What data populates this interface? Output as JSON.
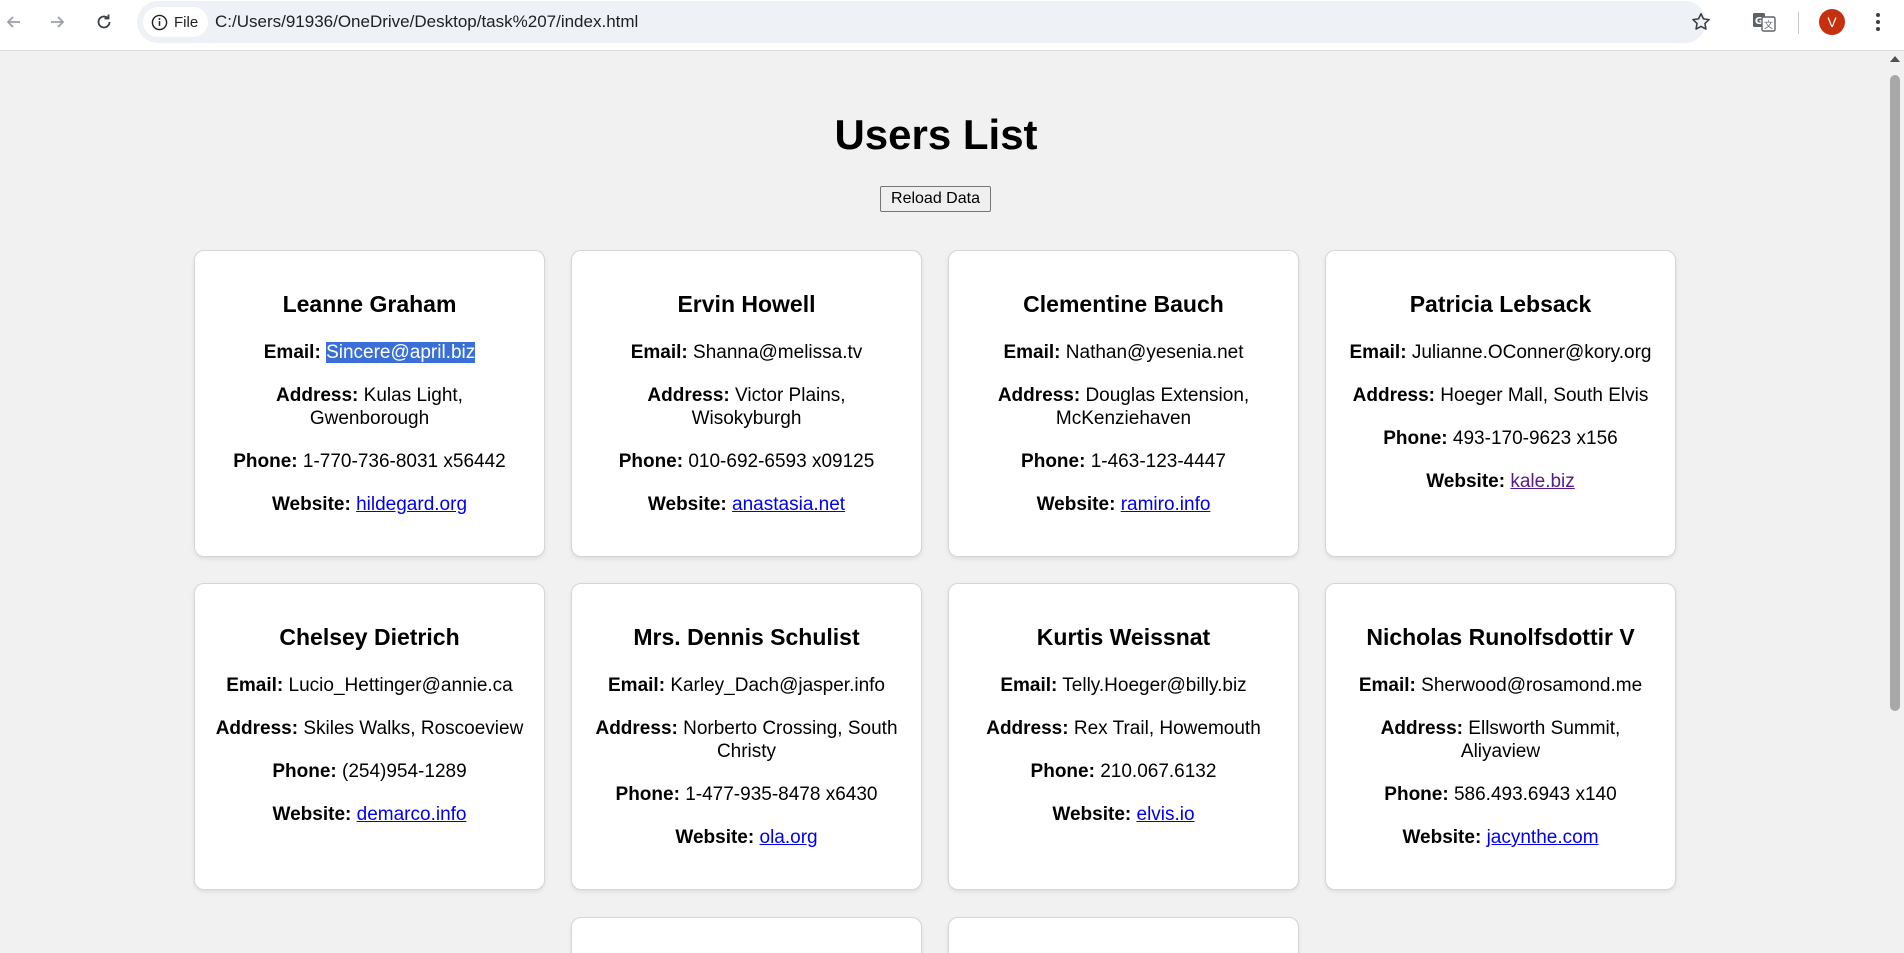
{
  "browser": {
    "file_label": "File",
    "url": "C:/Users/91936/OneDrive/Desktop/task%207/index.html",
    "avatar_letter": "V",
    "icons": [
      "back-arrow-icon",
      "forward-arrow-icon",
      "reload-icon",
      "info-icon",
      "star-icon",
      "translate-icon",
      "menu-dots-icon"
    ]
  },
  "page": {
    "title": "Users List",
    "reload_button": "Reload Data"
  },
  "labels": {
    "email": "Email:",
    "address": "Address:",
    "phone": "Phone:",
    "website": "Website:"
  },
  "users": [
    {
      "name": "Leanne Graham",
      "email": "Sincere@april.biz",
      "address": "Kulas Light, Gwenborough",
      "phone": "1-770-736-8031 x56442",
      "website": "hildegard.org"
    },
    {
      "name": "Ervin Howell",
      "email": "Shanna@melissa.tv",
      "address": "Victor Plains, Wisokyburgh",
      "phone": "010-692-6593 x09125",
      "website": "anastasia.net"
    },
    {
      "name": "Clementine Bauch",
      "email": "Nathan@yesenia.net",
      "address": "Douglas Extension, McKenziehaven",
      "phone": "1-463-123-4447",
      "website": "ramiro.info"
    },
    {
      "name": "Patricia Lebsack",
      "email": "Julianne.OConner@kory.org",
      "address": "Hoeger Mall, South Elvis",
      "phone": "493-170-9623 x156",
      "website": "kale.biz"
    },
    {
      "name": "Chelsey Dietrich",
      "email": "Lucio_Hettinger@annie.ca",
      "address": "Skiles Walks, Roscoeview",
      "phone": "(254)954-1289",
      "website": "demarco.info"
    },
    {
      "name": "Mrs. Dennis Schulist",
      "email": "Karley_Dach@jasper.info",
      "address": "Norberto Crossing, South Christy",
      "phone": "1-477-935-8478 x6430",
      "website": "ola.org"
    },
    {
      "name": "Kurtis Weissnat",
      "email": "Telly.Hoeger@billy.biz",
      "address": "Rex Trail, Howemouth",
      "phone": "210.067.6132",
      "website": "elvis.io"
    },
    {
      "name": "Nicholas Runolfsdottir V",
      "email": "Sherwood@rosamond.me",
      "address": "Ellsworth Summit, Aliyaview",
      "phone": "586.493.6943 x140",
      "website": "jacynthe.com"
    }
  ],
  "colors": {
    "link": "#0000ee",
    "visited_link": "#551a8b",
    "selection": "#3a6fd8",
    "avatar": "#c5310f"
  }
}
